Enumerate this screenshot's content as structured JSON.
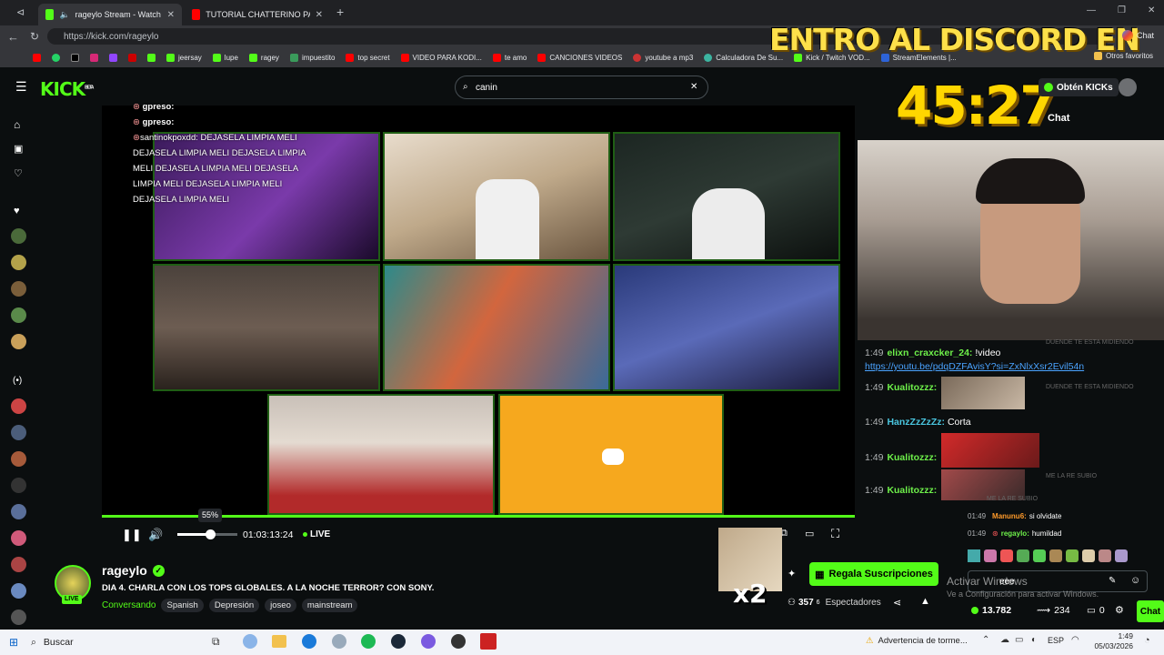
{
  "browser": {
    "tabs": [
      {
        "label": "rageylo Stream - Watch Live o",
        "active": true
      },
      {
        "label": "TUTORIAL CHATTERINO PARA KIC",
        "active": false
      }
    ],
    "url": "https://kick.com/rageylo",
    "bookmarks": [
      "jeersay",
      "lupe",
      "ragey",
      "impuestito",
      "top secret",
      "VIDEO PARA KODI...",
      "te amo",
      "CANCIONES VIDEOS",
      "youtube a mp3",
      "Calculadora De Su...",
      "Kick / Twitch VOD...",
      "StreamElements |...",
      "Otros favoritos"
    ],
    "chat_button": "Chat",
    "colors": {
      "chrome_dark": "#202124",
      "chrome_mid": "#35363a"
    }
  },
  "kick": {
    "logo": "KICK",
    "logo_badge": "BETA",
    "search_value": "canin",
    "get_kicks": "Obtén KICKs",
    "chat_header": "Chat",
    "accent": "#53fc18"
  },
  "overlay": {
    "banner": "ENTRO AL DISCORD EN",
    "timer": "45:27",
    "combo": "x2"
  },
  "stream_chat": [
    {
      "user": "gpreso:",
      "msg": ""
    },
    {
      "user": "gpreso:",
      "msg": ""
    },
    {
      "user": "santinokpoxdd:",
      "msg": "DEJASELA LIMPIA MELI"
    },
    {
      "user": "",
      "msg": "DEJASELA LIMPIA MELI  DEJASELA LIMPIA"
    },
    {
      "user": "",
      "msg": "MELI  DEJASELA LIMPIA MELI  DEJASELA"
    },
    {
      "user": "",
      "msg": "LIMPIA MELI  DEJASELA LIMPIA MELI"
    },
    {
      "user": "",
      "msg": "DEJASELA LIMPIA MELI"
    }
  ],
  "side_chat": [
    {
      "time": "1:49",
      "user": "elixn_craxcker_24:",
      "msg": "!video",
      "link": "https://youtu.be/pdqDZFAvisY?si=ZxNlxXsr2Evil54n"
    },
    {
      "time": "1:49",
      "user": "Kualitozzz:",
      "msg": ""
    },
    {
      "time": "1:49",
      "user": "HanzZzZzZz:",
      "msg": "Corta"
    },
    {
      "time": "1:49",
      "user": "Kualitozzz:",
      "msg": ""
    },
    {
      "time": "1:49",
      "user": "Kualitozzz:",
      "msg": ""
    }
  ],
  "faded_chat": [
    "DUENDE TE ESTA MIDIENDO",
    "DUENDE TE ESTA MIDIENDO",
    "ME LA RE SUBIO",
    "ME LA RE SUBIO"
  ],
  "small_chat": [
    {
      "time": "01:49",
      "user": "Manunu6:",
      "msg": "si olvidate"
    },
    {
      "time": "01:49",
      "user": "regaylo:",
      "msg": "humildad"
    }
  ],
  "player": {
    "volume_pct": "55%",
    "volume_level": 0.55,
    "elapsed": "01:03:13:24",
    "live_label": "LIVE",
    "progress": 1.0
  },
  "channel": {
    "name": "rageylo",
    "live_badge": "LIVE",
    "title": "DIA 4. CHARLA CON LOS TOPS GLOBALES. A LA NOCHE TERROR? CON SONY.",
    "category": "Conversando",
    "tags": [
      "Spanish",
      "Depresión",
      "joseo",
      "mainstream"
    ],
    "viewers": "357",
    "viewers_sup": "6",
    "viewers_label": "Espectadores",
    "gift_button": "Regala Suscripciones"
  },
  "chat_input": {
    "value": "eee",
    "kicks": "13.782",
    "count": "234",
    "zero": "0",
    "chat_button": "Chat"
  },
  "windows_activation": {
    "title": "Activar Windows",
    "subtitle": "Ve a Configuración para activar Windows."
  },
  "taskbar": {
    "search": "Buscar",
    "weather": "Advertencia de torme...",
    "lang": "ESP",
    "time": "1:49",
    "date": "05/03/2026"
  }
}
